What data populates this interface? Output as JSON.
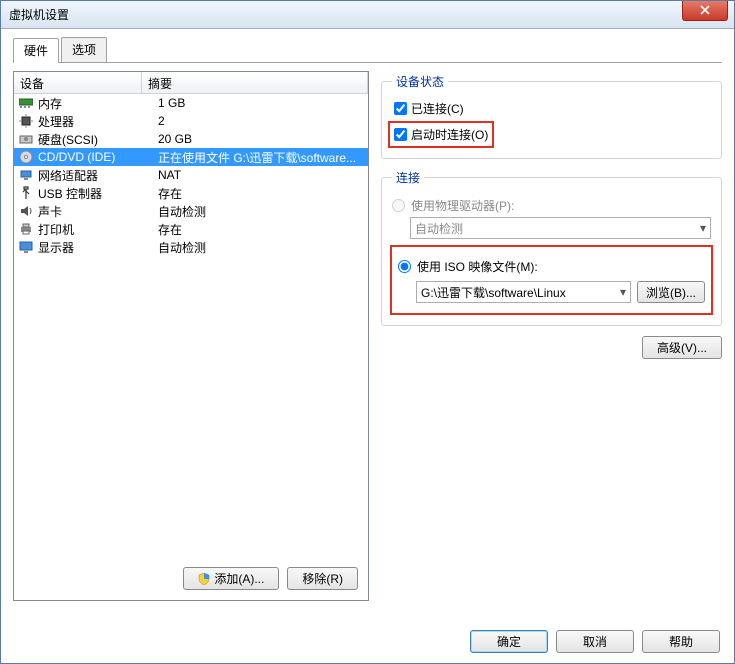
{
  "window": {
    "title": "虚拟机设置"
  },
  "tabs": {
    "hardware": "硬件",
    "options": "选项"
  },
  "list": {
    "col_device": "设备",
    "col_summary": "摘要",
    "rows": [
      {
        "icon": "memory-icon",
        "device": "内存",
        "summary": "1 GB"
      },
      {
        "icon": "cpu-icon",
        "device": "处理器",
        "summary": "2"
      },
      {
        "icon": "disk-icon",
        "device": "硬盘(SCSI)",
        "summary": "20 GB"
      },
      {
        "icon": "cd-icon",
        "device": "CD/DVD (IDE)",
        "summary": "正在使用文件 G:\\迅雷下载\\software...",
        "selected": true
      },
      {
        "icon": "network-icon",
        "device": "网络适配器",
        "summary": "NAT"
      },
      {
        "icon": "usb-icon",
        "device": "USB 控制器",
        "summary": "存在"
      },
      {
        "icon": "sound-icon",
        "device": "声卡",
        "summary": "自动检测"
      },
      {
        "icon": "printer-icon",
        "device": "打印机",
        "summary": "存在"
      },
      {
        "icon": "display-icon",
        "device": "显示器",
        "summary": "自动检测"
      }
    ],
    "add_btn": "添加(A)...",
    "remove_btn": "移除(R)"
  },
  "status": {
    "legend": "设备状态",
    "connected": "已连接(C)",
    "connect_at_poweron": "启动时连接(O)"
  },
  "connection": {
    "legend": "连接",
    "use_physical": "使用物理驱动器(P):",
    "physical_value": "自动检测",
    "use_iso": "使用 ISO 映像文件(M):",
    "iso_path": "G:\\迅雷下载\\software\\Linux",
    "browse": "浏览(B)...",
    "advanced": "高级(V)..."
  },
  "footer": {
    "ok": "确定",
    "cancel": "取消",
    "help": "帮助"
  }
}
